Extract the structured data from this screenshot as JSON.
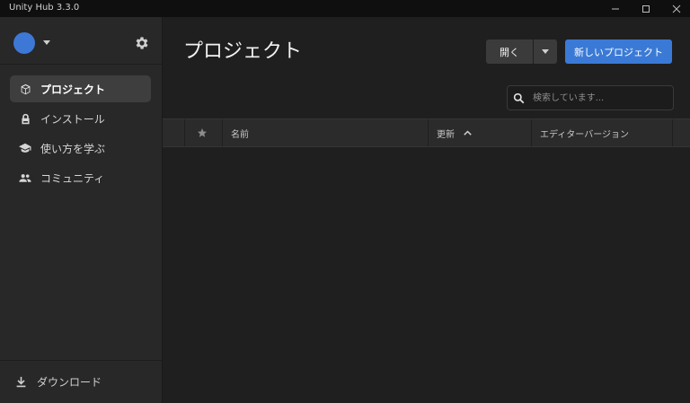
{
  "window": {
    "title": "Unity Hub 3.3.0",
    "controls": [
      "minimize-icon",
      "maximize-icon",
      "close-icon"
    ]
  },
  "sidebar": {
    "items": [
      {
        "label": "プロジェクト",
        "icon": "cube-icon",
        "active": true
      },
      {
        "label": "インストール",
        "icon": "lock-icon",
        "active": false
      },
      {
        "label": "使い方を学ぶ",
        "icon": "graduation-cap-icon",
        "active": false
      },
      {
        "label": "コミュニティ",
        "icon": "people-icon",
        "active": false
      }
    ],
    "download_label": "ダウンロード"
  },
  "main": {
    "title": "プロジェクト",
    "open_label": "開く",
    "new_project_label": "新しいプロジェクト",
    "search": {
      "placeholder": "検索しています..."
    },
    "table": {
      "columns": [
        "名前",
        "更新",
        "エディターバージョン"
      ],
      "sort_column": "更新",
      "sort_direction": "ascending"
    }
  },
  "colors": {
    "accent": "#3a7ad6",
    "avatar": "#3d78d6",
    "background": "#1f1f1f",
    "sidebar": "#282828"
  }
}
